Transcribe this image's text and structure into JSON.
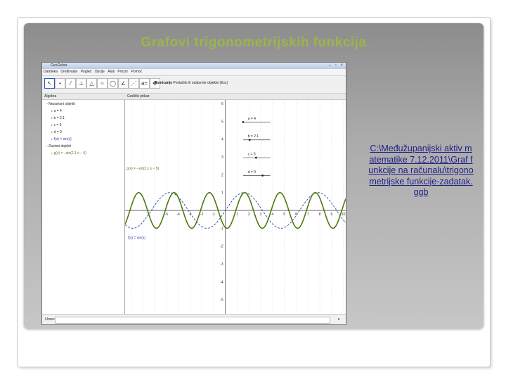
{
  "slide": {
    "title": "Grafovi trigonometrijskih funkcija",
    "link_text": "C:\\Međužupanijski aktiv matematike 7.12.2011\\Graf funkcije na računalu\\trigonometrijske funkcije-zadatak.ggb"
  },
  "geogebra": {
    "window_title": "GeoGebra",
    "window_buttons": "– ▫ ×",
    "menu": [
      "Datoteka",
      "Uređivanje",
      "Pogled",
      "Opcije",
      "Alati",
      "Prozor",
      "Pomoć"
    ],
    "mode_label": "Pomicanje",
    "mode_hint": "Povlačite ili odaberite objekte (Esc)",
    "algebra_header": "Algebra",
    "graphics_header": "Grafički prikaz",
    "free_objects_label": "Nezavisni objekti",
    "free_objects": [
      "a = 4",
      "b = 2.1",
      "c = 5",
      "d = 0",
      "f(x) = sin(x)"
    ],
    "dependent_objects_label": "Zavisni objekti",
    "dependent_objects": [
      "g(x) = −sin(2.1 x − 5)"
    ],
    "input_label": "Unos:",
    "graph_label_g": "g(x) = −sin(2.1 x − 5)",
    "graph_label_f": "f(x) = sin(x)",
    "slider_labels": [
      "a = 4",
      "b = 2.1",
      "c = 5",
      "d = 0"
    ],
    "y_ticks": [
      "6",
      "5",
      "4",
      "3",
      "2",
      "1",
      "-1",
      "-2",
      "-3",
      "-4",
      "-5"
    ],
    "x_ticks": [
      "-5",
      "-4",
      "-3",
      "-2",
      "-1",
      "1",
      "2",
      "3",
      "4",
      "5",
      "6",
      "7",
      "8",
      "9",
      "10"
    ],
    "colors": {
      "g_curve": "#4e7a12",
      "f_curve": "#2f43a8",
      "slider": "#222222"
    }
  },
  "chart_data": {
    "type": "line",
    "x_range": [
      -8.5,
      10.2
    ],
    "y_range": [
      -5.8,
      6.2
    ],
    "series": [
      {
        "name": "g(x) = −sin(2.1 x − 5)",
        "function": "-sin(2.1*x - 5)",
        "style": "solid"
      },
      {
        "name": "f(x) = sin(x)",
        "function": "sin(x)",
        "style": "dashed"
      }
    ]
  }
}
